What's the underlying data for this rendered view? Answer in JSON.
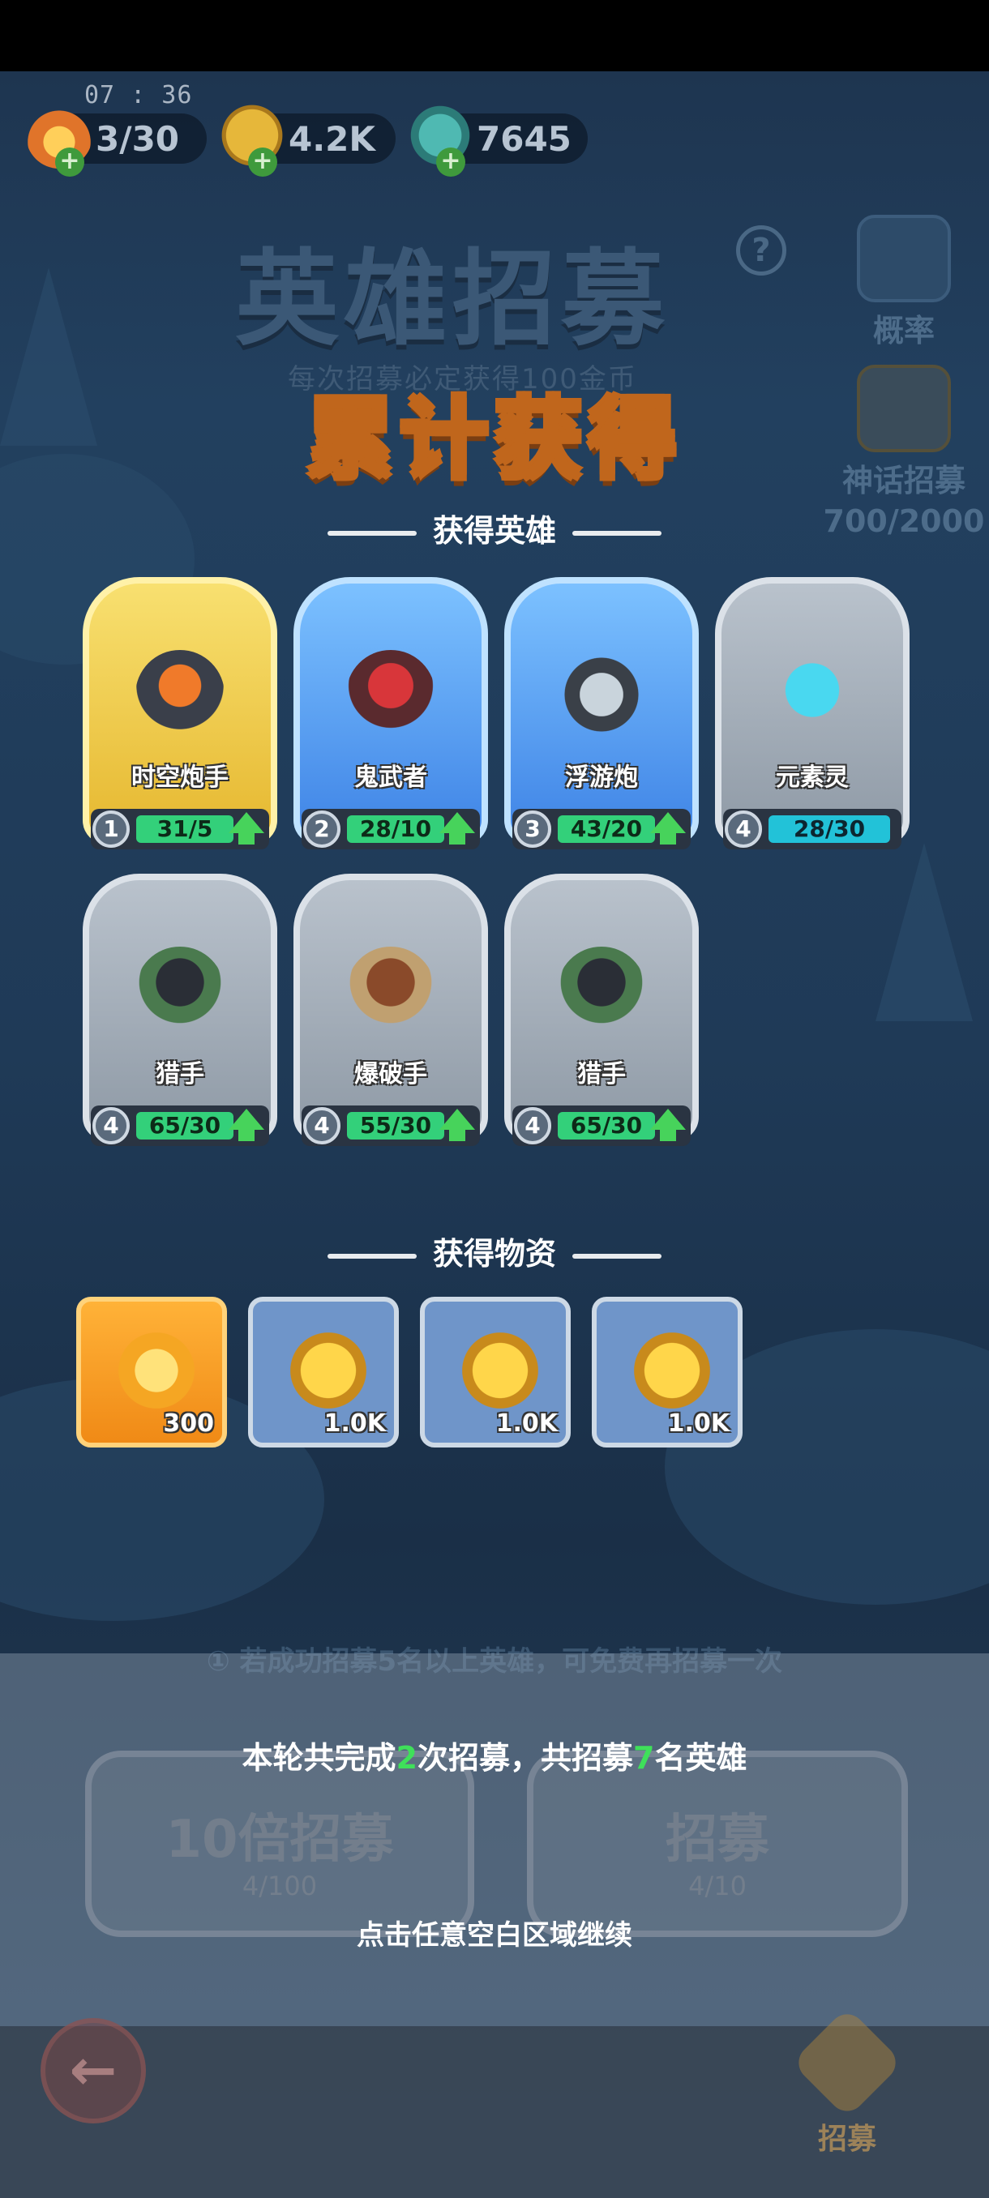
{
  "status": {
    "time": "07 : 36"
  },
  "resources": [
    {
      "icon": "flame-icon",
      "value": "3/30"
    },
    {
      "icon": "gold-coin-icon",
      "value": "4.2K"
    },
    {
      "icon": "crystal-icon",
      "value": "7645"
    }
  ],
  "background": {
    "title": "英雄招募",
    "subtitle": "每次招募必定获得100金币",
    "help_glyph": "?",
    "probability_label": "概率",
    "mythic_label": "神话招募",
    "mythic_progress": "700/2000"
  },
  "headline": "累计获得",
  "heroes_section": {
    "title": "获得英雄",
    "heroes": [
      {
        "name": "时空炮手",
        "level": "1",
        "count": "31/5",
        "rarity": "gold",
        "upgradable": true
      },
      {
        "name": "鬼武者",
        "level": "2",
        "count": "28/10",
        "rarity": "blue",
        "upgradable": true
      },
      {
        "name": "浮游炮",
        "level": "3",
        "count": "43/20",
        "rarity": "blue",
        "upgradable": true
      },
      {
        "name": "元素灵",
        "level": "4",
        "count": "28/30",
        "rarity": "grey",
        "upgradable": false
      },
      {
        "name": "猎手",
        "level": "4",
        "count": "65/30",
        "rarity": "grey",
        "upgradable": true
      },
      {
        "name": "爆破手",
        "level": "4",
        "count": "55/30",
        "rarity": "grey",
        "upgradable": true
      },
      {
        "name": "猎手",
        "level": "4",
        "count": "65/30",
        "rarity": "grey",
        "upgradable": true
      }
    ]
  },
  "items_section": {
    "title": "获得物资",
    "items": [
      {
        "icon": "crystal-shard-icon",
        "value": "300"
      },
      {
        "icon": "gold-coin-icon",
        "value": "1.0K"
      },
      {
        "icon": "gold-coin-icon",
        "value": "1.0K"
      },
      {
        "icon": "gold-coin-icon",
        "value": "1.0K"
      }
    ]
  },
  "notice": "① 若成功招募5名以上英雄，可免费再招募一次",
  "buttons": {
    "ten_recruit_label": "10倍招募",
    "ten_recruit_cost": "4/100",
    "recruit_label": "招募",
    "recruit_cost": "4/10"
  },
  "summary": {
    "part1": "本轮共完成",
    "rounds": "2",
    "part2": "次招募，共招募",
    "heroes": "7",
    "part3": "名英雄"
  },
  "continue_hint": "点击任意空白区域继续",
  "nav": {
    "back_glyph": "←",
    "recruit_label": "招募"
  },
  "colors": {
    "accent_green": "#3fe05a",
    "headline_outline": "#c0661c",
    "overlay_bg": "#1e3550"
  }
}
